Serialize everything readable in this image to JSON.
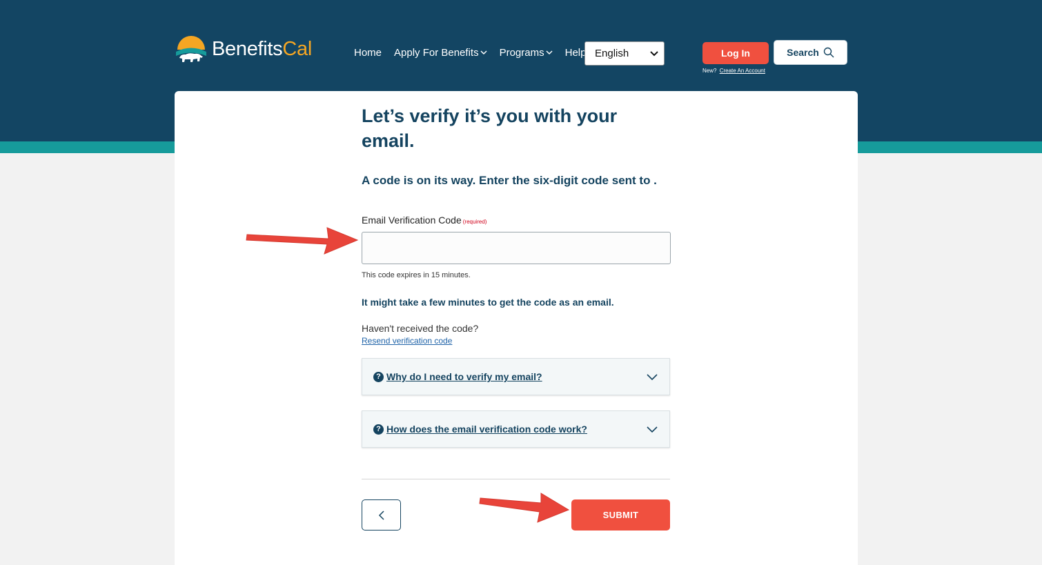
{
  "brand": {
    "name_part1": "Benefits",
    "name_part2": "Cal",
    "accent": "#f5a623",
    "header_color": "#134563"
  },
  "nav": {
    "items": [
      {
        "label": "Home",
        "has_dropdown": false
      },
      {
        "label": "Apply For Benefits",
        "has_dropdown": true
      },
      {
        "label": "Programs",
        "has_dropdown": true
      },
      {
        "label": "Help",
        "has_dropdown": false
      }
    ],
    "language": "English"
  },
  "auth": {
    "login_label": "Log In",
    "new_label": "New?",
    "create_account_label": "Create An Account",
    "search_label": "Search"
  },
  "main": {
    "title": "Let’s verify it’s you with your email.",
    "subtitle": "A code is on its way. Enter the six-digit code sent to .",
    "field_label": "Email Verification Code",
    "required_label": "(required)",
    "code_value": "",
    "hint": "This code expires in 15 minutes.",
    "note": "It might take a few minutes to get the code as an email.",
    "question": "Haven't received the code?",
    "resend_label": "Resend verification code"
  },
  "accordions": [
    {
      "label": "Why do I need to verify my email?"
    },
    {
      "label": "How does the email verification code work?"
    }
  ],
  "actions": {
    "submit_label": "SUBMIT"
  },
  "colors": {
    "primary_button": "#f0503f",
    "teal": "#169b9b",
    "text": "#14435f"
  }
}
